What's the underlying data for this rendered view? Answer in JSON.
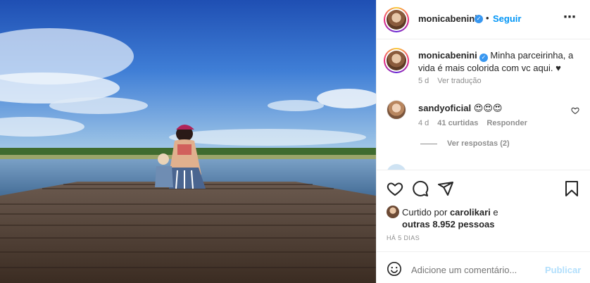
{
  "header": {
    "username": "monicabenini",
    "separator": "•",
    "follow_label": "Seguir",
    "more_icon": "⋯"
  },
  "caption": {
    "username": "monicabenini",
    "text": "Minha parceirinha, a vida é mais colorida com vc aqui. ♥",
    "age": "5 d",
    "translate_label": "Ver tradução"
  },
  "comment": {
    "username": "sandyoficial",
    "text": "😍😍😍",
    "age": "4 d",
    "likes": "41 curtidas",
    "reply_label": "Responder",
    "view_replies": "Ver respostas (2)"
  },
  "likes": {
    "prefix": "Curtido por",
    "liker": "carolikari",
    "joiner": "e",
    "others": "outras 8.952 pessoas"
  },
  "post_age": "HÁ 5 DIAS",
  "add_comment": {
    "placeholder": "Adicione um comentário...",
    "post_label": "Publicar"
  },
  "colors": {
    "accent": "#0095f6",
    "verified": "#3897f0",
    "muted": "#8e8e8e"
  }
}
